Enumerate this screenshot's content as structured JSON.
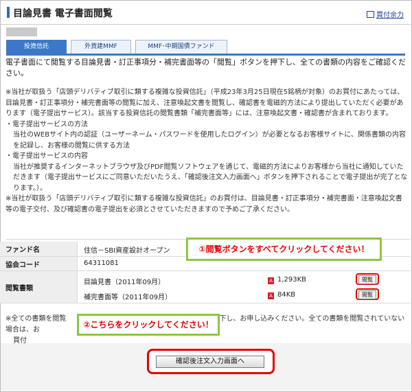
{
  "header": {
    "title": "目論見書 電子書面閲覧",
    "buying_power_link": "買付余力"
  },
  "tabs": [
    {
      "label": "投資信託",
      "active": true
    },
    {
      "label": "外貨建MMF",
      "active": false
    },
    {
      "label": "MMF･中期国債ファンド",
      "active": false
    }
  ],
  "intro": "電子書面にて閲覧する目論見書・訂正事項分・補完書面等の「閲覧」ボタンを押下し、全ての書類の内容をご確認ください。",
  "notes": [
    "※当社が取扱う「店頭デリバティブ取引に類する複雑な投資信託」（平成23年3月25日現在5銘柄が対象）のお買付にあたっては、目論見書・訂正事項分・補完書面等の閲覧に加え、注意喚起文書を閲覧し、確認書を電磁的方法により提出していただく必要があります（電子提出サービス）。該当する投資信託の閲覧書類「補完書面等」には、注意喚起文書・確認書が含まれております。",
    "・電子提出サービスの方法",
    "当社のWEBサイト内の認証（ユーザーネーム・パスワードを使用したログイン）が必要となるお客様サイトに、関係書類の内容を記録し、お客様の閲覧に供する方法",
    "・電子提出サービスの内容",
    "当社が推奨するインターネットブラウザ及びPDF閲覧ソフトウェアを通じて、電磁的方法によりお客様から当社に通知していただきます（電子提出サービスにご同意いただいたうえ、「確認後注文入力画面へ」ボタンを押下されることで電子提出が完了となります。）。",
    "※当社が取扱う「店頭デリバティブ取引に類する複雑な投資信託」のお買付は、目論見書・訂正事項分・補完書面・注意喚起文書等の電子交付、及び確認書の電子提出を必須とさせていただきますので予めご了承ください。"
  ],
  "fund": {
    "name_label": "ファンド名",
    "name_value": "住信－SBI資産設計オープン",
    "code_label": "協会コード",
    "code_value": "64311081",
    "docs_label": "閲覧書類",
    "docs": [
      {
        "name": "目論見書（2011年09月）",
        "size": "1,293KB",
        "button": "閲覧"
      },
      {
        "name": "補完書面等（2011年09月）",
        "size": "84KB",
        "button": "閲覧"
      }
    ]
  },
  "callouts": {
    "first": "①閲覧ボタンをすべてクリックしてください！",
    "second": "②こちらをクリックしてください！"
  },
  "bottom_note": {
    "left": "※全ての書類を閲覧",
    "right": "を押下し、お申し込みください。全ての書類を閲覧されていない場合は、お",
    "tail": "買付"
  },
  "confirm_button": "確認後注文入力画面へ",
  "colors": {
    "accent_blue": "#3b78c7",
    "highlight_red": "#e60000",
    "callout_green": "#8cc63f"
  }
}
